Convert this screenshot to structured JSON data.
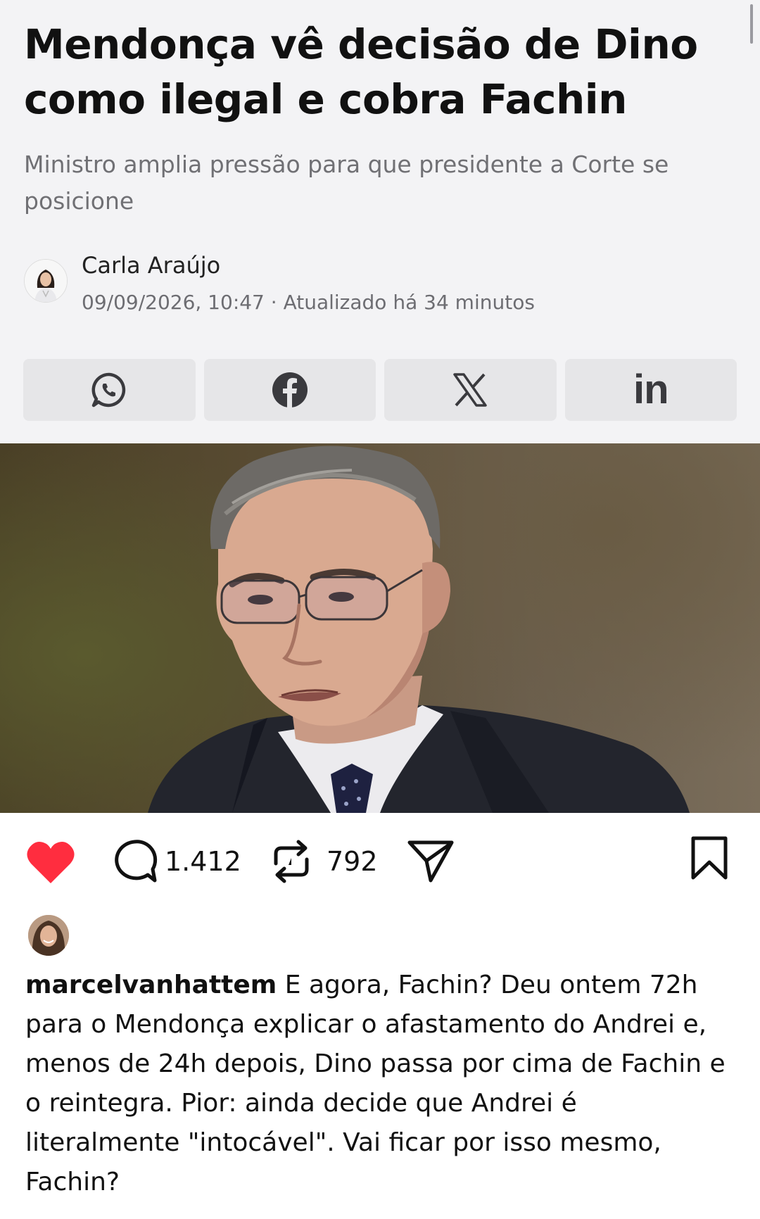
{
  "article": {
    "headline": "Mendonça vê decisão de Dino como ilegal e cobra Fachin",
    "subtitle": "Ministro amplia pressão para que presidente a Corte se posicione",
    "author": {
      "name": "Carla Araújo",
      "meta": "09/09/2026, 10:47 · Atualizado há 34 minutos"
    },
    "share_buttons": [
      {
        "icon": "whatsapp-icon"
      },
      {
        "icon": "facebook-icon"
      },
      {
        "icon": "x-icon"
      },
      {
        "icon": "linkedin-icon",
        "label": "in"
      }
    ]
  },
  "post": {
    "photo_icon": "photo-of-man-with-glasses",
    "comments_count": "1.412",
    "reposts_count": "792",
    "liked": true,
    "like_color": "#ff2d3f",
    "caption_user": "marcelvanhattem",
    "caption_text": "E agora, Fachin? Deu ontem 72h para o Mendonça explicar o afastamento do Andrei e, menos de 24h depois, Dino passa por cima de Fachin e o reintegra. Pior: ainda decide que Andrei é literalmente \"intocável\". Vai ficar por isso mesmo, Fachin?"
  }
}
